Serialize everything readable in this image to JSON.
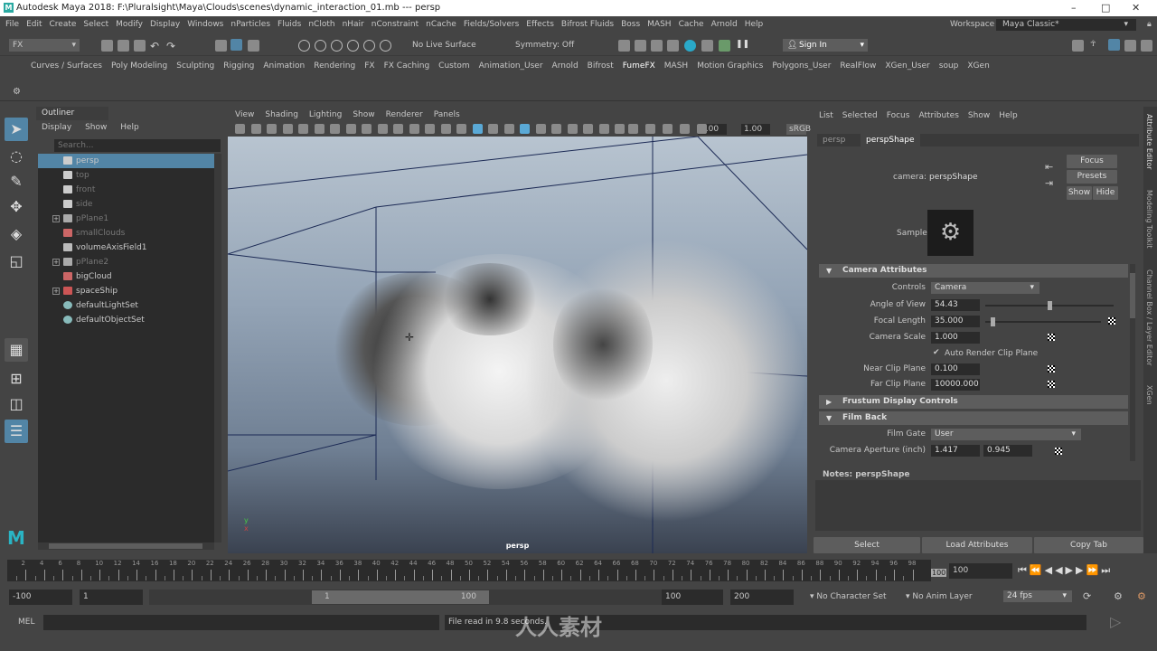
{
  "window": {
    "title": "Autodesk Maya 2018: F:\\Pluralsight\\Maya\\Clouds\\scenes\\dynamic_interaction_01.mb  ---  persp",
    "logo": "M"
  },
  "menubar": {
    "items": [
      "File",
      "Edit",
      "Create",
      "Select",
      "Modify",
      "Display",
      "Windows",
      "nParticles",
      "Fluids",
      "nCloth",
      "nHair",
      "nConstraint",
      "nCache",
      "Fields/Solvers",
      "Effects",
      "Bifrost Fluids",
      "Boss",
      "MASH",
      "Cache",
      "Arnold",
      "Help"
    ],
    "workspace_label": "Workspace :",
    "workspace_value": "Maya Classic*"
  },
  "statusline": {
    "menuset": "FX",
    "live_surface": "No Live Surface",
    "symmetry": "Symmetry: Off",
    "sign_in": "Sign In"
  },
  "shelf": {
    "tabs": [
      "Curves / Surfaces",
      "Poly Modeling",
      "Sculpting",
      "Rigging",
      "Animation",
      "Rendering",
      "FX",
      "FX Caching",
      "Custom",
      "Animation_User",
      "Arnold",
      "Bifrost",
      "FumeFX",
      "MASH",
      "Motion Graphics",
      "Polygons_User",
      "RealFlow",
      "XGen_User",
      "soup",
      "XGen"
    ],
    "active": "FumeFX"
  },
  "outliner": {
    "title": "Outliner",
    "menu": [
      "Display",
      "Show",
      "Help"
    ],
    "search_placeholder": "Search...",
    "items": [
      {
        "label": "persp",
        "icon": "camera-icon",
        "selected": true,
        "dim": false,
        "expand": false
      },
      {
        "label": "top",
        "icon": "camera-icon",
        "dim": true,
        "expand": false
      },
      {
        "label": "front",
        "icon": "camera-icon",
        "dim": true,
        "expand": false
      },
      {
        "label": "side",
        "icon": "camera-icon",
        "dim": true,
        "expand": false
      },
      {
        "label": "pPlane1",
        "icon": "plane-icon",
        "dim": true,
        "expand": true
      },
      {
        "label": "smallClouds",
        "icon": "fluid-icon",
        "dim": true,
        "expand": false
      },
      {
        "label": "volumeAxisField1",
        "icon": "field-icon",
        "dim": false,
        "expand": false
      },
      {
        "label": "pPlane2",
        "icon": "plane-icon",
        "dim": true,
        "expand": true
      },
      {
        "label": "bigCloud",
        "icon": "fluid-icon",
        "dim": false,
        "expand": false
      },
      {
        "label": "spaceShip",
        "icon": "mesh-icon",
        "dim": false,
        "expand": true
      },
      {
        "label": "defaultLightSet",
        "icon": "set-icon",
        "dim": false,
        "expand": false
      },
      {
        "label": "defaultObjectSet",
        "icon": "set-icon",
        "dim": false,
        "expand": false
      }
    ]
  },
  "viewport": {
    "menu": [
      "View",
      "Shading",
      "Lighting",
      "Show",
      "Renderer",
      "Panels"
    ],
    "exposure": "0.00",
    "gamma": "1.00",
    "colorspace": "sRGB",
    "camera": "persp"
  },
  "attribute_editor": {
    "menu": [
      "List",
      "Selected",
      "Focus",
      "Attributes",
      "Show",
      "Help"
    ],
    "tabs": [
      "persp",
      "perspShape"
    ],
    "active_tab": "perspShape",
    "node_label": "camera:",
    "node_name": "perspShape",
    "buttons": {
      "focus": "Focus",
      "presets": "Presets",
      "show": "Show",
      "hide": "Hide"
    },
    "sample_label": "Sample",
    "sections": {
      "camera_attributes": "Camera Attributes",
      "frustum": "Frustum Display Controls",
      "film_back": "Film Back"
    },
    "fields": {
      "controls_label": "Controls",
      "controls": "Camera",
      "aov_label": "Angle of View",
      "aov": "54.43",
      "focal_label": "Focal Length",
      "focal": "35.000",
      "scale_label": "Camera Scale",
      "scale": "1.000",
      "auto_clip": "Auto Render Clip Plane",
      "near_label": "Near Clip Plane",
      "near": "0.100",
      "far_label": "Far Clip Plane",
      "far": "10000.000",
      "gate_label": "Film Gate",
      "gate": "User",
      "aperture_label": "Camera Aperture (inch)",
      "aperture_x": "1.417",
      "aperture_y": "0.945"
    },
    "aov_fraction": 0.5,
    "focal_fraction": 0.05,
    "notes": "Notes:  perspShape",
    "footer": [
      "Select",
      "Load Attributes",
      "Copy Tab"
    ]
  },
  "side_tabs": [
    "Attribute Editor",
    "Modeling Toolkit",
    "Channel Box / Layer Editor",
    "XGen"
  ],
  "timeline": {
    "ticks": [
      2,
      4,
      6,
      8,
      10,
      12,
      14,
      16,
      18,
      20,
      22,
      24,
      26,
      28,
      30,
      32,
      34,
      36,
      38,
      40,
      42,
      44,
      46,
      48,
      50,
      52,
      54,
      56,
      58,
      60,
      62,
      64,
      66,
      68,
      70,
      72,
      74,
      76,
      78,
      80,
      82,
      84,
      86,
      88,
      90,
      92,
      94,
      96,
      98
    ],
    "end_label": "100",
    "current_frame": "100"
  },
  "range": {
    "anim_start": "-100",
    "playback_start": "1",
    "slider_start": "1",
    "slider_end": "100",
    "playback_end": "100",
    "anim_end": "200",
    "character_set": "No Character Set",
    "anim_layer": "No Anim Layer",
    "fps": "24 fps"
  },
  "command_line": {
    "label": "MEL",
    "result": "File read in  9.8 seconds."
  },
  "watermark": "人人素材"
}
